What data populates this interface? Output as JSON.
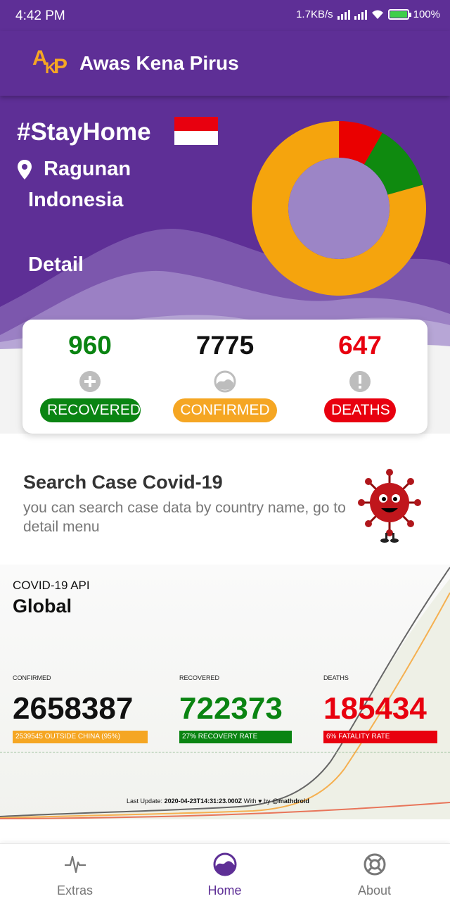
{
  "status_bar": {
    "time": "4:42 PM",
    "net_speed": "1.7KB/s",
    "battery": "100%"
  },
  "app_bar": {
    "logo_letters": [
      "A",
      "K",
      "P"
    ],
    "title": "Awas Kena Pirus"
  },
  "hero": {
    "hashtag": "#StayHome",
    "location_city": "Ragunan",
    "location_country": "Indonesia",
    "detail_label": "Detail",
    "flag_colors": [
      "#e8000f",
      "#ffffff"
    ]
  },
  "chart_data": {
    "type": "pie",
    "categories": [
      "Deaths",
      "Recovered",
      "Confirmed"
    ],
    "values": [
      647,
      960,
      6168
    ],
    "colors": [
      "#ea0000",
      "#0f8a0f",
      "#f5a40d"
    ]
  },
  "stats": [
    {
      "value": "960",
      "label": "RECOVERED",
      "color": "#0a8412",
      "icon": "plus-circle-icon"
    },
    {
      "value": "7775",
      "label": "CONFIRMED",
      "color": "#f5a623",
      "icon": "wave-circle-icon"
    },
    {
      "value": "647",
      "label": "DEATHS",
      "color": "#e8000f",
      "icon": "exclamation-circle-icon"
    }
  ],
  "search_card": {
    "title": "Search Case Covid-19",
    "description": "you can search case data by country name, go to detail menu"
  },
  "global": {
    "api_label": "COVID-19 API",
    "title": "Global",
    "columns": [
      {
        "caption": "CONFIRMED",
        "value": "2658387",
        "bar_text": "2539545 OUTSIDE CHINA (95%)",
        "color": "#111111",
        "bar_color": "#f5a623"
      },
      {
        "caption": "RECOVERED",
        "value": "722373",
        "bar_text": "27% RECOVERY RATE",
        "color": "#0a8412",
        "bar_color": "#0a8412"
      },
      {
        "caption": "DEATHS",
        "value": "185434",
        "bar_text": "6% FATALITY RATE",
        "color": "#e8000f",
        "bar_color": "#e8000f"
      }
    ],
    "last_update_prefix": "Last Update:",
    "last_update_value": "2020-04-23T14:31:23.000Z",
    "last_update_with": "With",
    "last_update_by": "by",
    "last_update_author": "@mathdroid"
  },
  "bottom_nav": [
    {
      "label": "Extras",
      "icon": "heartbeat-icon",
      "active": false
    },
    {
      "label": "Home",
      "icon": "home-wave-icon",
      "active": true
    },
    {
      "label": "About",
      "icon": "lifebuoy-icon",
      "active": false
    }
  ],
  "colors": {
    "primary": "#5e2f96",
    "accent": "#f5a623",
    "nav_active": "#5e2f96",
    "nav_inactive": "#777777"
  }
}
